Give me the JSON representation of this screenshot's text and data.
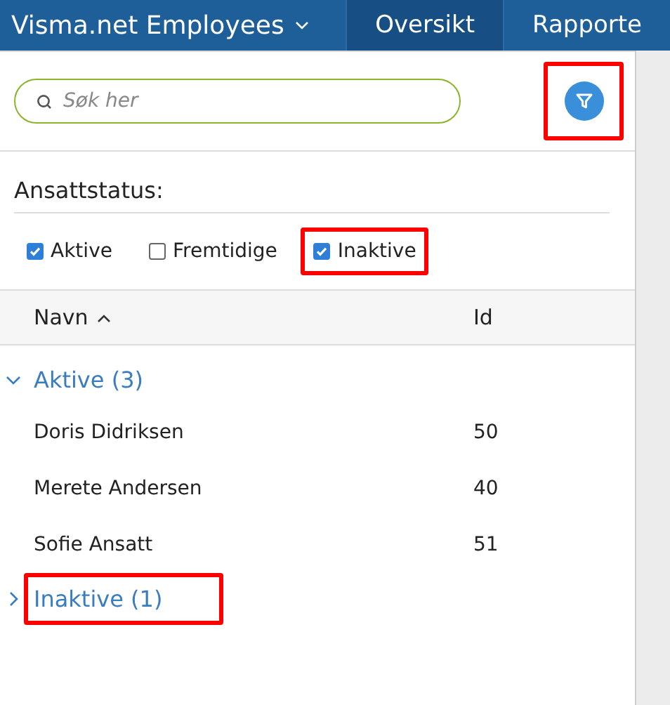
{
  "nav": {
    "app_title": "Visma.net Employees",
    "tabs": [
      {
        "label": "Oversikt",
        "selected": true
      },
      {
        "label": "Rapporte",
        "selected": false
      }
    ]
  },
  "search": {
    "placeholder": "Søk her"
  },
  "filter_button": {
    "highlighted": true
  },
  "status_filter": {
    "label": "Ansattstatus:",
    "options": [
      {
        "label": "Aktive",
        "checked": true,
        "highlighted": false
      },
      {
        "label": "Fremtidige",
        "checked": false,
        "highlighted": false
      },
      {
        "label": "Inaktive",
        "checked": true,
        "highlighted": true
      }
    ]
  },
  "table": {
    "columns": [
      "Navn",
      "Id"
    ],
    "groups": [
      {
        "label": "Aktive (3)",
        "expanded": true,
        "highlighted": false,
        "rows": [
          {
            "name": "Doris Didriksen",
            "id": "50"
          },
          {
            "name": "Merete Andersen",
            "id": "40"
          },
          {
            "name": "Sofie Ansatt",
            "id": "51"
          }
        ]
      },
      {
        "label": "Inaktive (1)",
        "expanded": false,
        "highlighted": true
      }
    ]
  }
}
